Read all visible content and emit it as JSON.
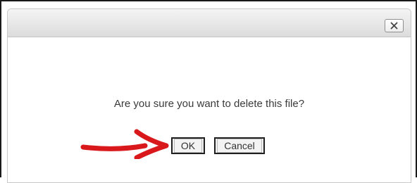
{
  "dialog": {
    "close_icon": "close-x-icon",
    "message": "Are you sure you want to delete this file?",
    "ok_label": "OK",
    "cancel_label": "Cancel"
  },
  "annotation": {
    "arrow_icon": "red-arrow-right-icon",
    "arrow_color": "#d9181c"
  },
  "colors": {
    "titlebar_top": "#f4f4f4",
    "titlebar_bottom": "#dcdcdc",
    "message_text": "#3a3a3a",
    "button_border": "#1f1f1f"
  }
}
